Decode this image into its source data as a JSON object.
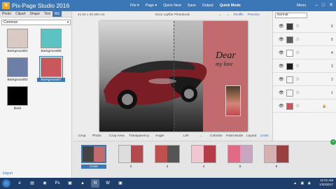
{
  "titlebar": {
    "app_title": "Pix-Page Studio 2016",
    "logo_text": "N",
    "menus": [
      "File ▾",
      "Page ▾",
      "Quick New",
      "Save",
      "Output",
      "Quick Mode"
    ],
    "menu_right": "Menu",
    "win_buttons": [
      "–",
      "□",
      "✕"
    ]
  },
  "left_panel": {
    "tabs": [
      "Photo",
      "Clipart",
      "Shape",
      "Text",
      "BG"
    ],
    "active_tab": "BG",
    "category": "Common",
    "backgrounds": [
      {
        "label": "Background01",
        "color": "#d9cbc4"
      },
      {
        "label": "Background05",
        "color": "#5dc3c2"
      },
      {
        "label": "Background03",
        "color": "#6c7fa6"
      },
      {
        "label": "Background07",
        "color": "#c9585c"
      },
      {
        "label": "black",
        "color": "#000000"
      }
    ],
    "import_label": "Import"
  },
  "center": {
    "size_text": "41.91 x 30.484 cm",
    "doc_title": "8x12 Layflat Photobook",
    "nav_prev": "←",
    "nav_next": "→",
    "shuffle": "Shuffle",
    "preview": "Preview",
    "love_text_line1": "Dear",
    "love_text_line2": "my love"
  },
  "toolbar": {
    "crop": "Crop",
    "photo": "Photo",
    "crop_area": "Crop Area",
    "transparency": "Transparency",
    "angle": "Angle",
    "lr": "L/R",
    "arrow": "→",
    "colorize": "Colorize",
    "paint_mode": "Paint Mode",
    "layout": "Layout",
    "undo": "Undo",
    "redo": "Redo",
    "more": "More ▾"
  },
  "thumbnails": [
    {
      "label": "Cover",
      "left": "#444444",
      "right": "#c26b6f"
    },
    {
      "label": "2",
      "left": "#dddddd",
      "right": "#b24a4e"
    },
    {
      "label": "3",
      "left": "#c0504d",
      "right": "#555555"
    },
    {
      "label": "4",
      "left": "#f2c6d0",
      "right": "#b63a48"
    },
    {
      "label": "5",
      "left": "#e26a86",
      "right": "#c8a6c0"
    },
    {
      "label": "6",
      "left": "#d4b0b0",
      "right": "#9a4040"
    }
  ],
  "right_panel": {
    "blend_mode": "Normal",
    "layers": [
      {
        "num": "6",
        "thumb": "#3a3a3a",
        "lock": ""
      },
      {
        "num": "5",
        "thumb": "#5a5a5a",
        "lock": ""
      },
      {
        "num": "4",
        "thumb": "#ffffff",
        "lock": ""
      },
      {
        "num": "3",
        "thumb": "#1a1a1a",
        "lock": ""
      },
      {
        "num": "2",
        "thumb": "#f4f4f4",
        "lock": ""
      },
      {
        "num": "1",
        "thumb": "#f4f4f4",
        "lock": ""
      },
      {
        "num": "",
        "thumb": "#c9585c",
        "lock": "🔒"
      }
    ]
  },
  "taskbar": {
    "time": "11:01 AM",
    "date": "1/30/2017",
    "icons": [
      "e",
      "▤",
      "◉",
      "Ps",
      "▣",
      "▲",
      "N",
      "W",
      "▣"
    ]
  },
  "colors": {
    "accent": "#3b76b6",
    "titlebar": "#3b76b6",
    "taskbar": "#1d3d6b"
  }
}
